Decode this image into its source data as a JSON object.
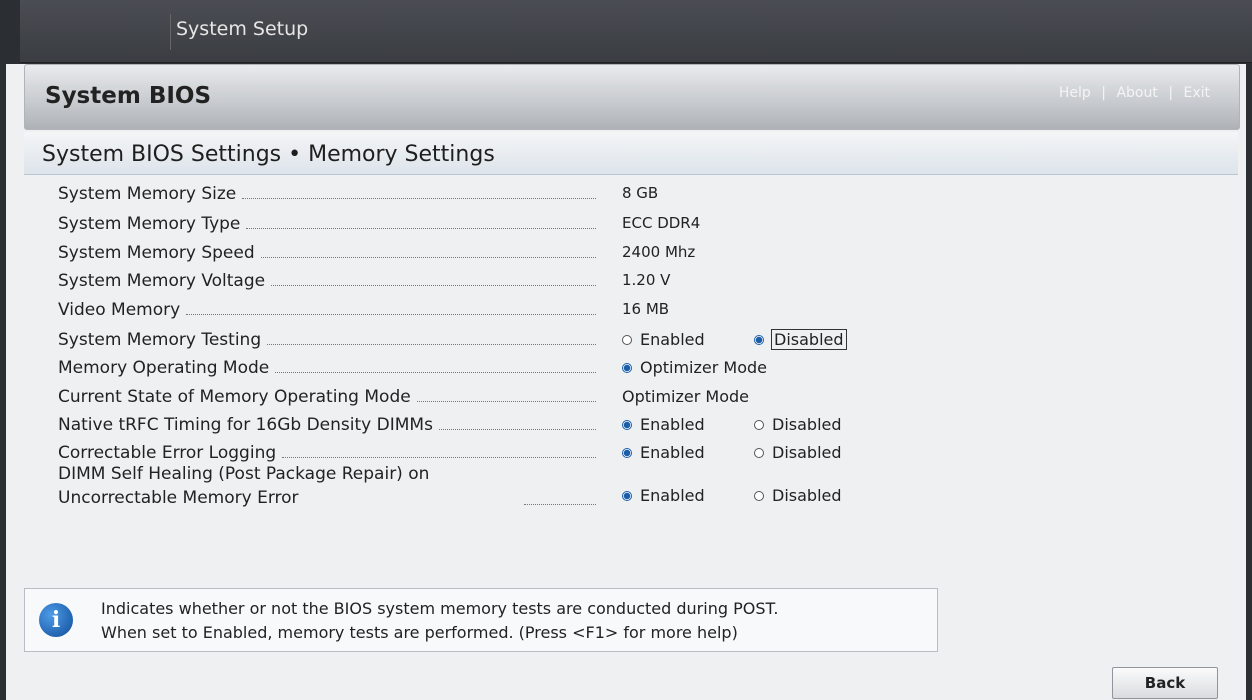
{
  "app": {
    "title": "System Setup"
  },
  "header": {
    "title": "System BIOS",
    "links": [
      "Help",
      "|",
      "About",
      "|",
      "Exit"
    ]
  },
  "section": {
    "title": "System BIOS Settings • Memory Settings"
  },
  "settings": {
    "memory_size": {
      "label": "System Memory Size",
      "value": "8 GB"
    },
    "memory_type": {
      "label": "System Memory Type",
      "value": "ECC DDR4"
    },
    "memory_speed": {
      "label": "System Memory Speed",
      "value": "2400 Mhz"
    },
    "memory_voltage": {
      "label": "System Memory Voltage",
      "value": "1.20 V"
    },
    "video_memory": {
      "label": "Video Memory",
      "value": "16 MB"
    },
    "memory_testing": {
      "label": "System Memory Testing",
      "opt1": "Enabled",
      "opt2": "Disabled"
    },
    "operating_mode": {
      "label": "Memory Operating Mode",
      "opt1": "Optimizer Mode"
    },
    "current_mode": {
      "label": "Current State of Memory Operating Mode",
      "value": "Optimizer Mode"
    },
    "trfc": {
      "label": "Native tRFC Timing for 16Gb Density DIMMs",
      "opt1": "Enabled",
      "opt2": "Disabled"
    },
    "error_logging": {
      "label": "Correctable Error Logging",
      "opt1": "Enabled",
      "opt2": "Disabled"
    },
    "self_healing": {
      "label": "DIMM Self Healing (Post Package Repair) on Uncorrectable Memory Error",
      "opt1": "Enabled",
      "opt2": "Disabled"
    }
  },
  "info": {
    "icon": "info-icon",
    "line1": "Indicates whether or not the BIOS system memory tests are conducted during POST.",
    "line2": "When set to Enabled, memory tests are performed. (Press <F1> for more help)"
  },
  "footer": {
    "back_label": "Back"
  }
}
